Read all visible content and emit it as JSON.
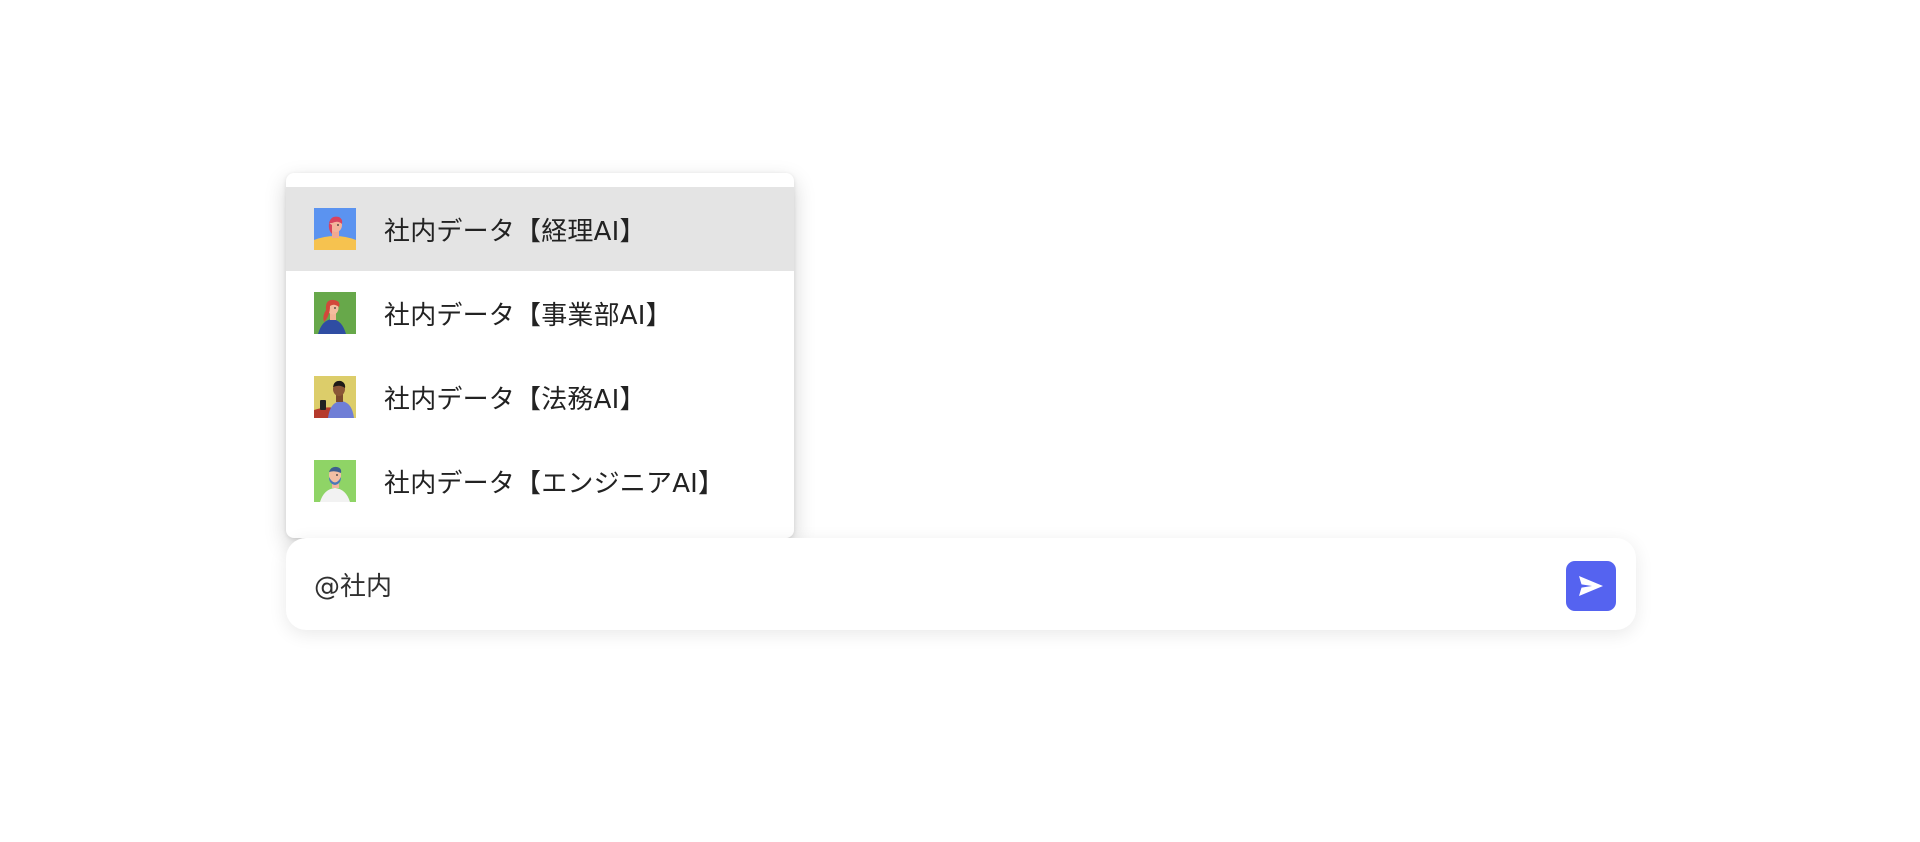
{
  "mention_menu": {
    "items": [
      {
        "label": "社内データ【経理AI】",
        "avatar_icon": "woman-pink-hair-avatar-icon",
        "selected": true
      },
      {
        "label": "社内データ【事業部AI】",
        "avatar_icon": "woman-red-hair-avatar-icon",
        "selected": false
      },
      {
        "label": "社内データ【法務AI】",
        "avatar_icon": "man-with-phone-avatar-icon",
        "selected": false
      },
      {
        "label": "社内データ【エンジニアAI】",
        "avatar_icon": "bearded-man-avatar-icon",
        "selected": false
      }
    ]
  },
  "composer": {
    "value": "@社内",
    "send_icon": "send-icon"
  },
  "colors": {
    "accent": "#5563f0",
    "selected_row": "#e4e4e4"
  }
}
